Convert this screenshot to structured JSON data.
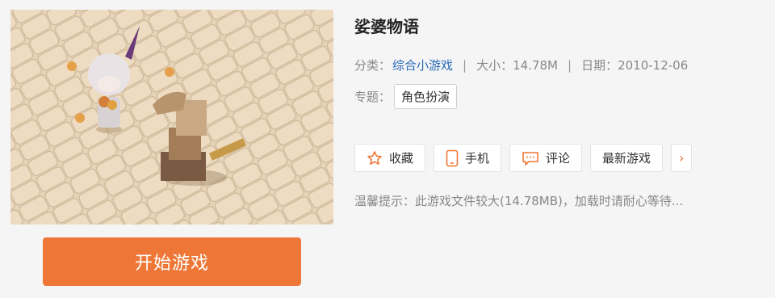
{
  "game": {
    "title": "娑婆物语",
    "play_label": "开始游戏"
  },
  "meta": {
    "category_label": "分类：",
    "category_value": "综合小游戏",
    "separator": "|",
    "size_label": "大小：",
    "size_value": "14.78M",
    "date_label": "日期：",
    "date_value": "2010-12-06"
  },
  "topic": {
    "label": "专题：",
    "tag": "角色扮演"
  },
  "actions": {
    "favorite": {
      "label": "收藏",
      "icon": "star-icon"
    },
    "mobile": {
      "label": "手机",
      "icon": "phone-icon"
    },
    "comment": {
      "label": "评论",
      "icon": "comment-icon"
    },
    "latest": {
      "label": "最新游戏"
    },
    "more": {
      "label": "›"
    }
  },
  "tip": "温馨提示：此游戏文件较大(14.78MB)，加载时请耐心等待...",
  "colors": {
    "accent": "#ee7737",
    "link": "#2a6ab8",
    "background": "#f5f5f6"
  }
}
